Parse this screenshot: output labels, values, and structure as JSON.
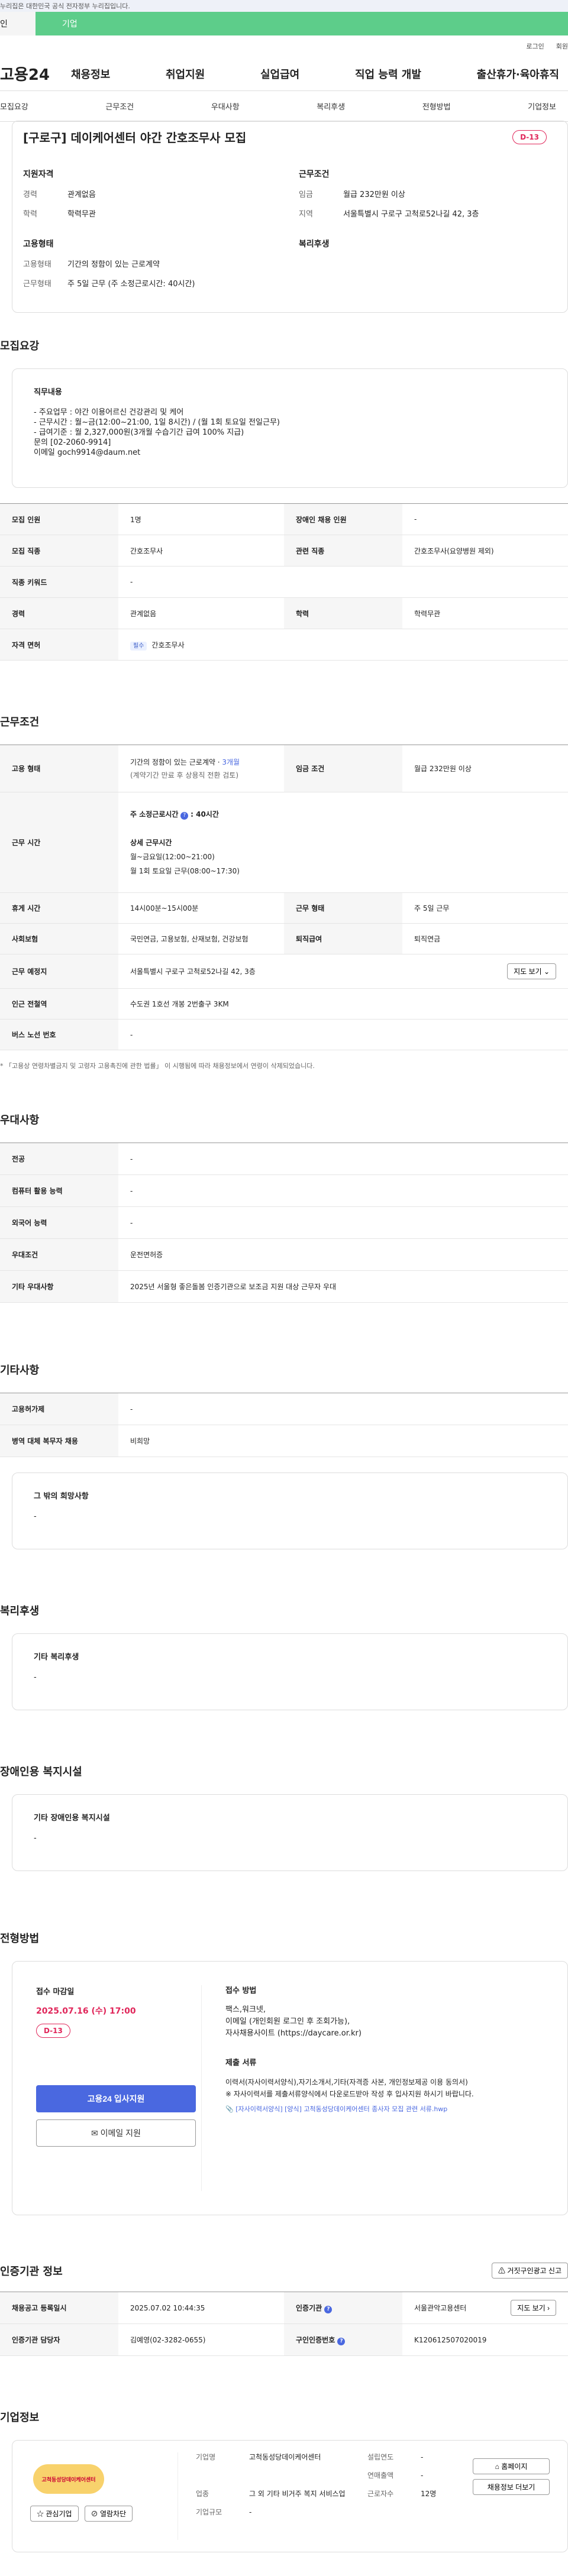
{
  "notice": "누리집은 대한민국 공식 전자정부 누리집입니다.",
  "type_tabs": [
    "인",
    "기업"
  ],
  "util": [
    "로그인",
    "회원"
  ],
  "logo": "고용24",
  "gnb": [
    "채용정보",
    "취업지원",
    "실업급여",
    "직업 능력 개발",
    "출산휴가·육아휴직"
  ],
  "anchors": [
    "모집요강",
    "근무조건",
    "우대사항",
    "복리후생",
    "전형방법",
    "기업정보"
  ],
  "summary": {
    "title": "[구로구] 데이케어센터 야간 간호조무사 모집",
    "dday": "D-13",
    "qual_title": "지원자격",
    "career_k": "경력",
    "career_v": "관계없음",
    "edu_k": "학력",
    "edu_v": "학력무관",
    "work_title": "근무조건",
    "wage_k": "임금",
    "wage_v": "월급 232만원 이상",
    "area_k": "지역",
    "area_v": "서울특별시 구로구 고척로52나길 42, 3층",
    "emp_title": "고용형태",
    "emp_k": "고용형태",
    "emp_v": "기간의 정함이 있는 근로계약",
    "shift_k": "근무형태",
    "shift_v": "주 5일 근무 (주 소정근로시간: 40시간)",
    "welfare_title": "복리후생"
  },
  "recruit": {
    "title": "모집요강",
    "duty_title": "직무내용",
    "duty_text": "- 주요업무 : 야간 이용어르신 건강관리 및 케어\n- 근무시간 : 월~금(12:00~21:00, 1일 8시간) / (월 1회 토요일 전일근무)\n- 급여기준 : 월 2,327,000원(3개월 수습기간 급여 100% 지급)\n문의 [02-2060-9914]\n이메일 goch9914@daum.net",
    "rows": [
      [
        "모집 인원",
        "1명",
        "장애인 채용 인원",
        "-"
      ],
      [
        "모집 직종",
        "간호조무사",
        "관련 직종",
        "간호조무사(요양병원 제외)"
      ],
      [
        "직종 키워드",
        "-"
      ],
      [
        "경력",
        "관계없음",
        "학력",
        "학력무관"
      ]
    ],
    "license_k": "자격 면허",
    "license_badge": "필수",
    "license_v": "간호조무사"
  },
  "work": {
    "title": "근무조건",
    "emp_k": "고용 형태",
    "emp_v1": "기간의 정함이 있는 근로계약 · ",
    "emp_v1b": "3개월",
    "emp_v2": "(계약기간 만료 후 상용직 전환 검토)",
    "wage_k": "임금 조건",
    "wage_v": "월급 232만원 이상",
    "hours_k": "근무 시간",
    "hours_l1": "주 소정근로시간",
    "hours_l1b": ": 40시간",
    "hours_l2": "상세 근무시간",
    "hours_l3": "월~금요일(12:00~21:00)",
    "hours_l4": "월 1회 토요일 근무(08:00~17:30)",
    "rest_k": "휴게 시간",
    "rest_v": "14시00분~15시00분",
    "form_k": "근무 형태",
    "form_v": "주 5일 근무",
    "ins_k": "사회보험",
    "ins_v": "국민연금, 고용보험, 산재보험, 건강보험",
    "ret_k": "퇴직급여",
    "ret_v": "퇴직연금",
    "place_k": "근무 예정지",
    "place_v": "서울특별시 구로구 고척로52나길 42, 3층",
    "map_btn": "지도 보기",
    "sub_k": "인근 전철역",
    "sub_v": "수도권 1호선 개봉 2번출구 3KM",
    "bus_k": "버스 노선 번호",
    "bus_v": "-",
    "footnote": "「고용상 연령차별금지 및 고령자 고용촉진에 관한 법률」 이 시행됨에 따라 채용정보에서 연령이 삭제되었습니다."
  },
  "pref": {
    "title": "우대사항",
    "rows": [
      [
        "전공",
        "-"
      ],
      [
        "컴퓨터 활용 능력",
        "-"
      ],
      [
        "외국어 능력",
        "-"
      ],
      [
        "우대조건",
        "운전면허증"
      ],
      [
        "기타 우대사항",
        "2025년 서울형 좋은돌봄 인증기관으로 보조금 지원 대상 근무자 우대"
      ]
    ]
  },
  "etc": {
    "title": "기타사항",
    "rows": [
      [
        "고용허가제",
        "-"
      ],
      [
        "병역 대체 복무자 채용",
        "비희망"
      ]
    ],
    "other_title": "그 밖의 희망사항",
    "other_v": "-"
  },
  "welfare": {
    "title": "복리후생",
    "box_title": "기타 복리후생",
    "box_v": "-"
  },
  "disab": {
    "title": "장애인용 복지시설",
    "box_title": "기타 장애인용 복지시설",
    "box_v": "-"
  },
  "apply": {
    "title": "전형방법",
    "deadline_k": "접수 마감일",
    "deadline_v": "2025.07.16 (수) 17:00",
    "dday": "D-13",
    "btn_main": "고용24 입사지원",
    "btn_email": "이메일 지원",
    "method_title": "접수 방법",
    "method_v": "팩스,워크넷,\n이메일 (개인회원 로그인 후 조회가능),\n자사채용사이트 (https://daycare.or.kr)",
    "docs_title": "제출 서류",
    "docs_v": "이력서(자사이력서양식),자기소개서,기타(자격증 사본, 개인정보제공 이용 동의서)\n※ 자사이력서를 제출서류양식에서 다운로드받아 작성 후 입사지원 하시기 바랍니다.",
    "file_v": "[자사이력서양식] [양식] 고척동성당데이케어센터 종사자 모집 관련 서류.hwp"
  },
  "cert": {
    "title": "인증기관 정보",
    "report_btn": "거짓구인광고 신고",
    "reg_k": "채용공고 등록일시",
    "reg_v": "2025.07.02 10:44:35",
    "org_k": "인증기관",
    "org_v": "서울관악고용센터",
    "map_btn": "지도 보기",
    "mgr_k": "인증기관 담당자",
    "mgr_v": "김예영(02-3282-0655)",
    "no_k": "구인인증번호",
    "no_v": "K120612507020019"
  },
  "company": {
    "title": "기업정보",
    "logo_text": "고척동성당데이케어센터",
    "interest_btn": "관심기업",
    "block_btn": "열람차단",
    "name_k": "기업명",
    "name_v": "고척동성당데이케어센터",
    "ind_k": "업종",
    "ind_v": "그 외 기타 비거주 복지 서비스업",
    "size_k": "기업규모",
    "size_v": "-",
    "est_k": "설립연도",
    "est_v": "-",
    "sales_k": "연매출액",
    "sales_v": "-",
    "emp_k": "근로자수",
    "emp_v": "12명",
    "home_btn": "홈페이지",
    "info_btn": "채용정보 더보기"
  },
  "colors": {
    "accent": "#4a68e0",
    "green": "#5dcd8a",
    "dday": "#e0265a"
  }
}
